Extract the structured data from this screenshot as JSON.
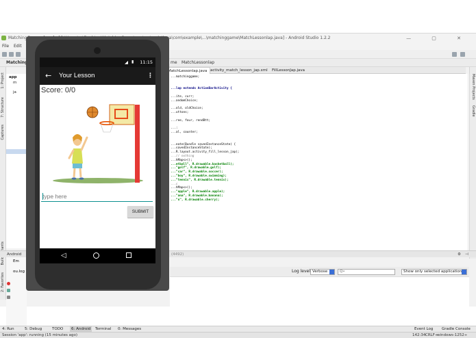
{
  "ide": {
    "window_title": "MatchingGame - [app] - [C:\\Users\\...\\Desktop\\MatchingGame\\app\\src\\main\\java\\com\\example\\...\\matchinggame\\MatchLessonlap.java] - Android Studio 1.2.2",
    "menu": [
      "File",
      "Edit",
      "Vi"
    ],
    "breadcrumbs": [
      "MatchingGame",
      "me",
      "MatchLessonlap"
    ],
    "tabs": [
      {
        "label": "MatchLessonlap.java",
        "active": true
      },
      {
        "label": "activity_match_lesson_jap.xml",
        "active": false
      },
      {
        "label": "FillLessonJap.java",
        "active": false
      }
    ],
    "project_tree": [
      "app",
      "m",
      "ja"
    ],
    "left_tool_labels": [
      "1: Project",
      "7: Structure",
      "Captures",
      "Build Variants",
      "2: Favorites"
    ],
    "right_tool_labels": [
      "Maven Projects",
      "Gradle"
    ],
    "code_lines": [
      {
        "text": "...matchinggame;",
        "cls": ""
      },
      {
        "text": "",
        "cls": ""
      },
      {
        "text": "",
        "cls": ""
      },
      {
        "text": "...lap extends ActionBarActivity {",
        "cls": "k"
      },
      {
        "text": "",
        "cls": ""
      },
      {
        "text": "...ite, curr;",
        "cls": ""
      },
      {
        "text": "...andomChoice;",
        "cls": ""
      },
      {
        "text": "",
        "cls": ""
      },
      {
        "text": "...old, oldChoice;",
        "cls": ""
      },
      {
        "text": "...uttons;",
        "cls": ""
      },
      {
        "text": "",
        "cls": ""
      },
      {
        "text": "...ree, four, rendBtt;",
        "cls": ""
      },
      {
        "text": "",
        "cls": ""
      },
      {
        "text": "...:",
        "cls": ""
      },
      {
        "text": "...al, counter;",
        "cls": ""
      },
      {
        "text": "",
        "cls": ""
      },
      {
        "text": "",
        "cls": ""
      },
      {
        "text": "...eate(Bundle savedInstanceState) {",
        "cls": ""
      },
      {
        "text": "...savedInstanceState);",
        "cls": ""
      },
      {
        "text": "...R.layout.activity_fill_lesson_jap);",
        "cls": ""
      },
      {
        "text": "...// nothing",
        "cls": "c"
      },
      {
        "text": "...hMap<>();",
        "cls": ""
      },
      {
        "text": "...etball\", R.drawable.basketball);",
        "cls": "s"
      },
      {
        "text": "...\"golf\", R.drawable.golf);",
        "cls": "s"
      },
      {
        "text": "...\"car\", R.drawable.soccer);",
        "cls": "s"
      },
      {
        "text": "...\"boy\", R.drawable.swimming);",
        "cls": "s"
      },
      {
        "text": "...\"tennis\", R.drawable.tennis);",
        "cls": "s"
      },
      {
        "text": "...c",
        "cls": "c"
      },
      {
        "text": "...hMap<>();",
        "cls": ""
      },
      {
        "text": "...\"apple\", R.drawable.apple);",
        "cls": "s"
      },
      {
        "text": "...\"ana\", R.drawable.banana);",
        "cls": "s"
      },
      {
        "text": "...\"n\", R.drawable.cherry);",
        "cls": "s"
      }
    ],
    "android_panel": {
      "label": "Android",
      "device_label": "Em",
      "log_label": "ou.log",
      "process": "(4492)"
    },
    "log_controls": {
      "level_label": "Log level:",
      "level_value": "Verbose",
      "search_placeholder": "Q•",
      "filter_value": "Show only selected application"
    },
    "bottom_tabs": [
      "4: Run",
      "5: Debug",
      "TODO",
      "6: Android",
      "Terminal",
      "0: Messages"
    ],
    "bottom_right_tabs": [
      "Event Log",
      "Gradle Console"
    ],
    "status_text": "Session 'app': running (15 minutes ago)",
    "status_right": [
      "142:34",
      "CRLF÷",
      "windows-1252÷"
    ]
  },
  "phone": {
    "status_time": "11:15",
    "app_title": "Your Lesson",
    "score_text": "Score: 0/0",
    "input_placeholder": "type here",
    "submit_label": "SUBMIT",
    "image_caption": "basketball illustration"
  }
}
